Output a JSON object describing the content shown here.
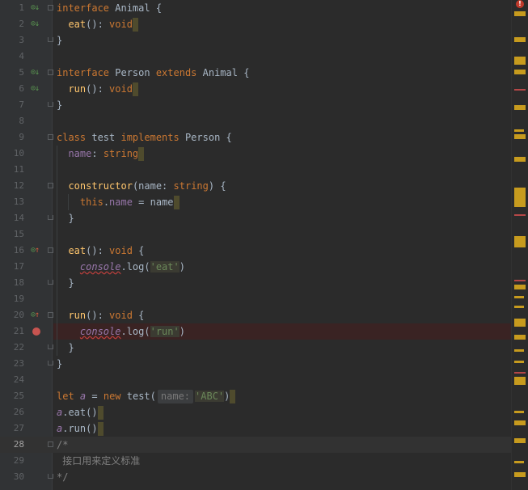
{
  "editor": {
    "current_line": 28,
    "lines": [
      {
        "n": "1",
        "gicon": "implemented",
        "fold": "start"
      },
      {
        "n": "2",
        "gicon": "implemented"
      },
      {
        "n": "3",
        "fold": "end"
      },
      {
        "n": "4"
      },
      {
        "n": "5",
        "gicon": "implemented",
        "fold": "start"
      },
      {
        "n": "6",
        "gicon": "implemented"
      },
      {
        "n": "7",
        "fold": "end"
      },
      {
        "n": "8"
      },
      {
        "n": "9",
        "fold": "start"
      },
      {
        "n": "10"
      },
      {
        "n": "11"
      },
      {
        "n": "12",
        "fold": "start"
      },
      {
        "n": "13"
      },
      {
        "n": "14",
        "fold": "end"
      },
      {
        "n": "15"
      },
      {
        "n": "16",
        "gicon": "overrides",
        "fold": "start"
      },
      {
        "n": "17"
      },
      {
        "n": "18",
        "fold": "end"
      },
      {
        "n": "19"
      },
      {
        "n": "20",
        "gicon": "overrides",
        "fold": "start"
      },
      {
        "n": "21",
        "breakpoint": true
      },
      {
        "n": "22",
        "fold": "end"
      },
      {
        "n": "23",
        "fold": "end"
      },
      {
        "n": "24"
      },
      {
        "n": "25"
      },
      {
        "n": "26"
      },
      {
        "n": "27"
      },
      {
        "n": "28",
        "fold": "start"
      },
      {
        "n": "29"
      },
      {
        "n": "30",
        "fold": "end"
      }
    ],
    "tokens": {
      "l1_kw": "interface",
      "l1_name": " Animal {",
      "l2_fn": "eat",
      "l2_rest": "(): ",
      "l2_type": "void",
      "l3": "}",
      "l5_kw": "interface",
      "l5_name": " Person ",
      "l5_kw2": "extends",
      "l5_rest": " Animal {",
      "l6_fn": "run",
      "l6_rest": "(): ",
      "l6_type": "void",
      "l7": "}",
      "l9_kw": "class",
      "l9_name": " test ",
      "l9_kw2": "implements",
      "l9_rest": " Person {",
      "l10_prop": "name",
      "l10_rest": ": ",
      "l10_type": "string",
      "l12_fn": "constructor",
      "l12_a": "(name: ",
      "l12_type": "string",
      "l12_b": ") {",
      "l13_kw": "this",
      "l13_dot": ".",
      "l13_prop": "name",
      "l13_rest": " = name",
      "l14": "}",
      "l16_fn": "eat",
      "l16_rest": "(): ",
      "l16_type": "void",
      "l16_brace": " {",
      "l17_obj": "console",
      "l17_a": ".log(",
      "l17_str": "'eat'",
      "l17_b": ")",
      "l18": "}",
      "l20_fn": "run",
      "l20_rest": "(): ",
      "l20_type": "void",
      "l20_brace": " {",
      "l21_obj": "console",
      "l21_a": ".log(",
      "l21_str": "'run'",
      "l21_b": ")",
      "l22": "}",
      "l23": "}",
      "l25_kw": "let",
      "l25_var": "a",
      "l25_eq": " = ",
      "l25_kw2": "new",
      "l25_call": " test(",
      "l25_hint": "name:",
      "l25_str": "'ABC'",
      "l25_end": ")",
      "l26_var": "a",
      "l26_rest": ".eat()",
      "l27_var": "a",
      "l27_rest": ".run()",
      "l28": "/*",
      "l29": " 接口用来定义标准",
      "l30": "*/"
    }
  },
  "error_stripe": {
    "error_indicator": "!"
  },
  "colors": {
    "background": "#2b2b2b",
    "gutter": "#313335",
    "keyword": "#cc7832",
    "function": "#ffc66d",
    "string": "#6a8759",
    "property": "#9876aa",
    "breakpoint": "#c75450",
    "marker": "#c79b1e"
  }
}
